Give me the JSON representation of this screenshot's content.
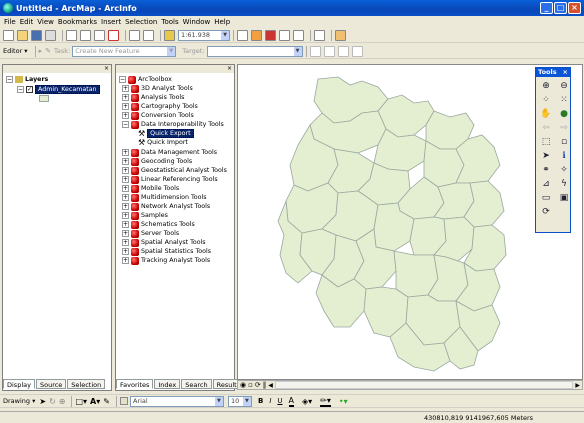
{
  "window": {
    "title": "Untitled - ArcMap - ArcInfo",
    "minimize": "_",
    "maximize": "□",
    "close": "×"
  },
  "menu": [
    "File",
    "Edit",
    "View",
    "Bookmarks",
    "Insert",
    "Selection",
    "Tools",
    "Window",
    "Help"
  ],
  "standard_toolbar": {
    "scale": "1:61.938"
  },
  "editor_toolbar": {
    "editor_label": "Editor ▾",
    "task_label": "Task:",
    "task_value": "Create New Feature",
    "target_label": "Target:",
    "target_value": ""
  },
  "toc": {
    "close": "×",
    "root": "Layers",
    "layer": "Admin_Kecamatan",
    "tabs": [
      "Display",
      "Source",
      "Selection"
    ]
  },
  "arctoolbox": {
    "close": "×",
    "root": "ArcToolbox",
    "items": [
      "3D Analyst Tools",
      "Analysis Tools",
      "Cartography Tools",
      "Conversion Tools",
      "Data Interoperability Tools"
    ],
    "subitems": [
      "Quick Export",
      "Quick Import"
    ],
    "items2": [
      "Data Management Tools",
      "Geocoding Tools",
      "Geostatistical Analyst Tools",
      "Linear Referencing Tools",
      "Mobile Tools",
      "Multidimension Tools",
      "Network Analyst Tools",
      "Samples",
      "Schematics Tools",
      "Server Tools",
      "Spatial Analyst Tools",
      "Spatial Statistics Tools",
      "Tracking Analyst Tools"
    ],
    "tabs": [
      "Favorites",
      "Index",
      "Search",
      "Results"
    ]
  },
  "tools_window": {
    "title": "Tools",
    "close": "×"
  },
  "drawing_toolbar": {
    "drawing": "Drawing ▾",
    "font": "Arial",
    "size": "10",
    "bold": "B",
    "italic": "I",
    "underline": "U",
    "font_color": "A"
  },
  "status": {
    "coords": "430810,819  9141967,605 Meters"
  },
  "colors": {
    "polygon_fill": "#e4eed0",
    "polygon_stroke": "#9aa8a0"
  }
}
